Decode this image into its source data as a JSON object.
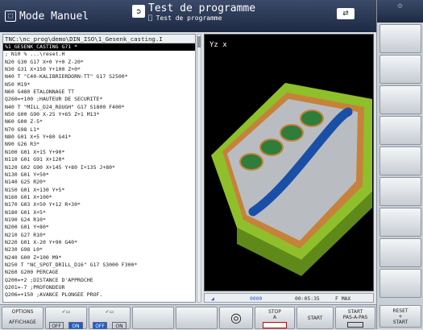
{
  "header": {
    "mode": "Mode Manuel",
    "title": "Test de programme",
    "subtitle": "Test de programme",
    "mode_icon": "machine-icon",
    "test_icon": "program-test-icon",
    "tool_icon": "tool-icon"
  },
  "program": {
    "path": "TNC:\\nc_prog\\demo\\DIN_ISO\\1_Gesenk_casting.I",
    "lines": [
      "%1_GESENK_CASTING G71 *",
      "; N10 % ...\\reset.H",
      "N20 G30 G17 X+0 Y+0 Z-20*",
      "N30 G31 X+150 Y+100 Z+0*",
      "N40 T \"C40-KALIBRIERDORN-TT\" G17 S2500*",
      "N50 M19*",
      "N60 G480 ETALONNAGE TT",
      "    Q260=+100  ;HAUTEUR DE SECURITE*",
      "N40 T \"MILL_D24_ROUGH\" G17 S1800 F400*",
      "N50 G00 G90 X-25 Y+65 Z+1 M13*",
      "N60 G00 Z-5*",
      "N70 G98 L1*",
      "N80 G01 X+5 Y+80 G41*",
      "N90 G26 R3*",
      "N100 G01 X+15 Y+90*",
      "N110 G01 G91 X+120*",
      "N120 G02 G90 X+145 Y+80 I+135 J+80*",
      "N130 G01 Y+50*",
      "N140 G25 R20*",
      "N150 G01 X+130 Y+5*",
      "N160 G01 X+100*",
      "N170 G03 X+50 Y+12 R+30*",
      "N180 G01 X+5*",
      "N190 G24 R10*",
      "N200 G01 Y+80*",
      "N210 G27 R10*",
      "N220 G01 X-20 Y+90 G40*",
      "N230 G98 L0*",
      "N240 G00 Z+100 M9*",
      "N250 T \"NC_SPOT_DRILL_D16\" G17 S3000 F300*",
      "N260 G200 PERCAGE",
      "    Q200=+2    ;DISTANCE D'APPROCHE",
      "    Q201=-7    ;PROFONDEUR",
      "    Q206=+150  ;AVANCE PLONGEE PROF."
    ]
  },
  "view": {
    "axis_label": "Yz x"
  },
  "status": {
    "time": "00:05:35",
    "feed": "F MAX",
    "dots": "0000"
  },
  "softkeys": {
    "options": "OPTIONS",
    "affichage": "AFFICHAGE",
    "off": "OFF",
    "on": "ON",
    "stop": "STOP",
    "a": "A",
    "start": "START",
    "start_pas": "START",
    "pas_a_pas": "PAS-A-PAS",
    "reset": "RESET",
    "plus": "+",
    "start2": "START"
  },
  "colors": {
    "header": "#1e2a44",
    "keyword": "#0b3fa8",
    "number": "#c06000",
    "selected": "#000000"
  }
}
